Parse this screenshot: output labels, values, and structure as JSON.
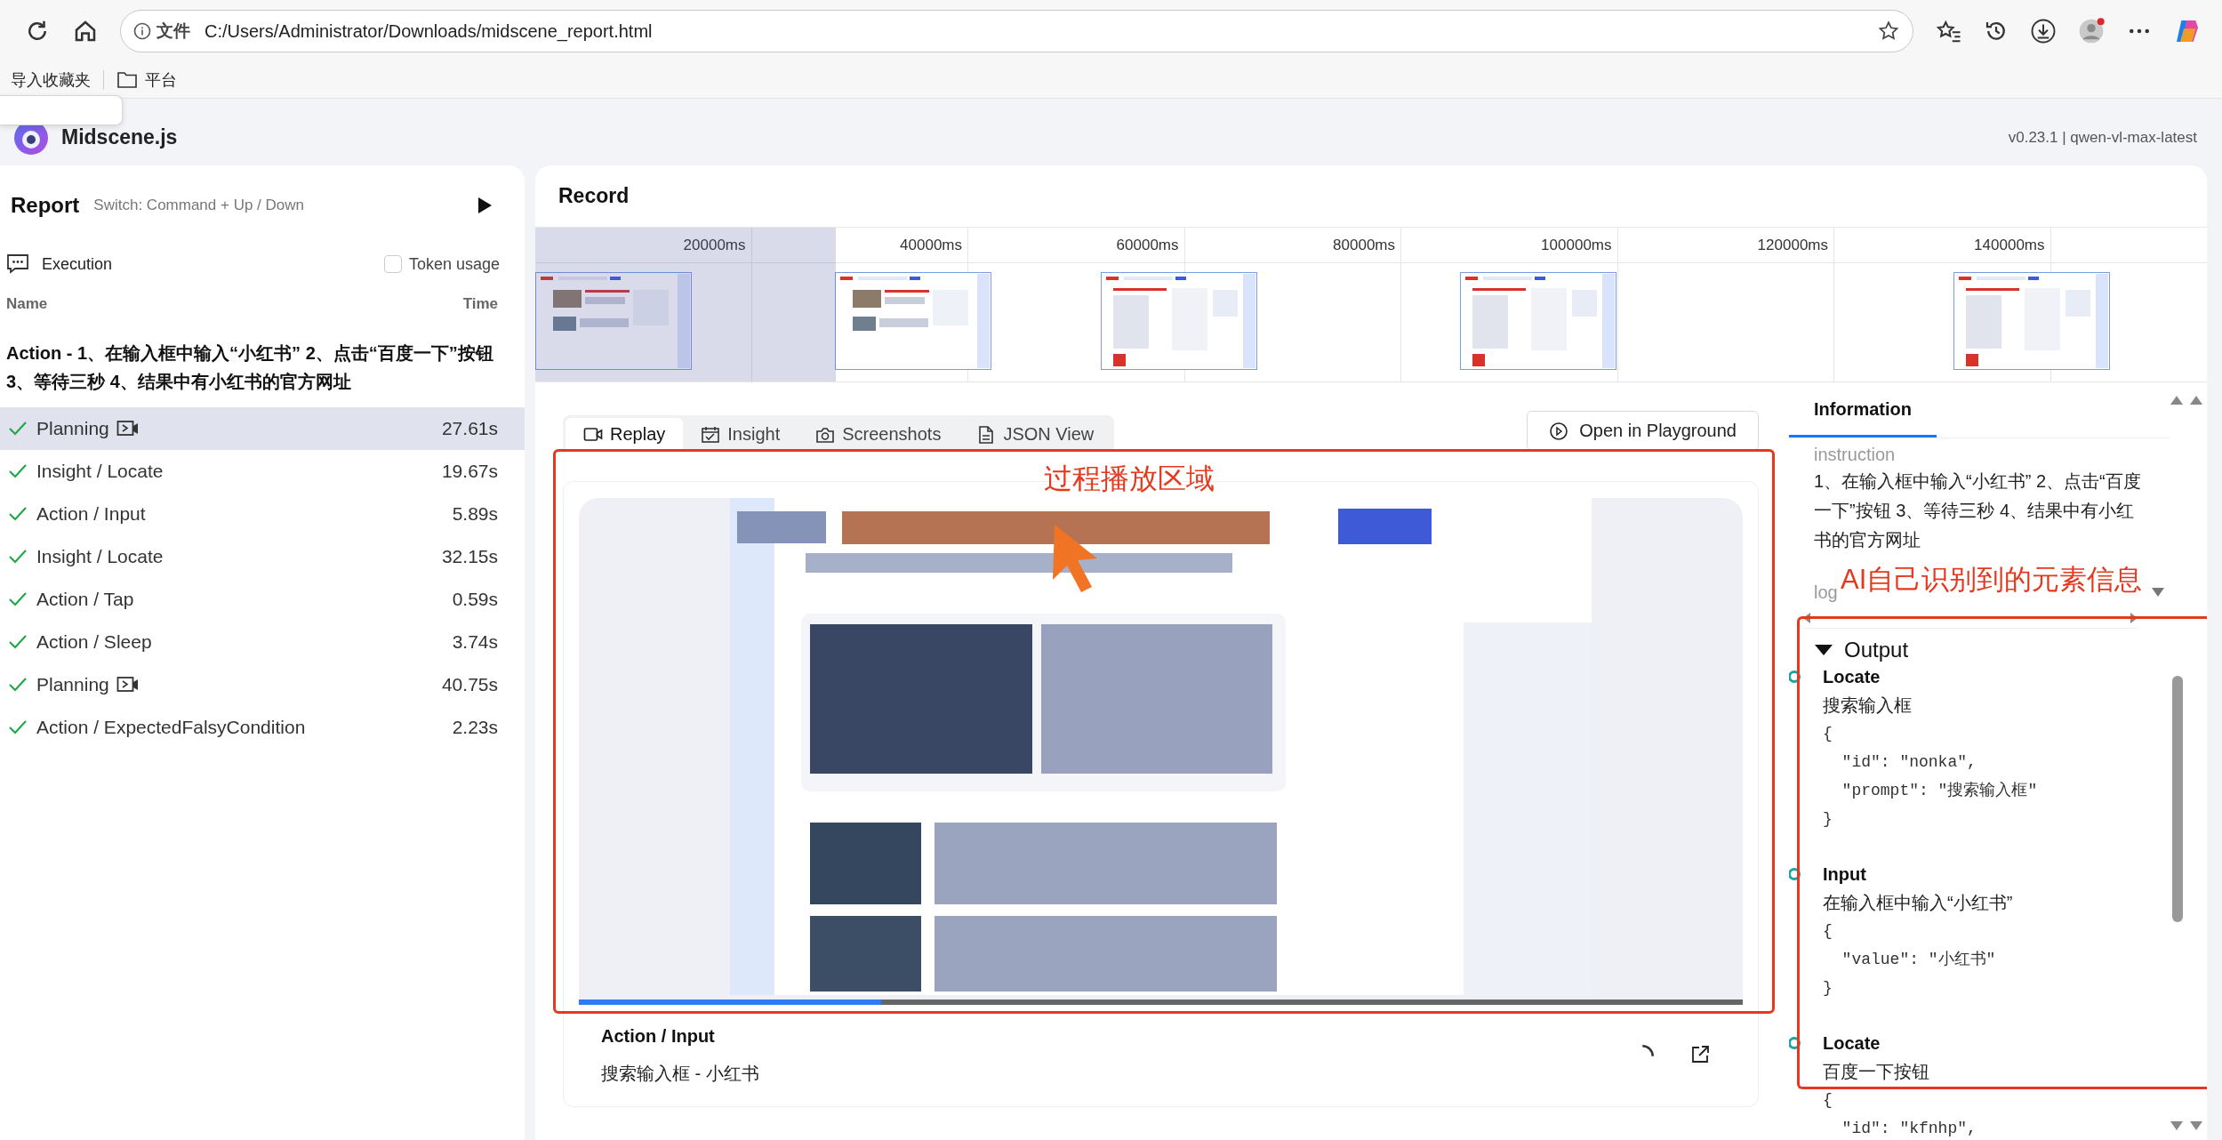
{
  "browser": {
    "address_prefix": "文件",
    "url": "C:/Users/Administrator/Downloads/midscene_report.html",
    "bookmarks": [
      {
        "kind": "link",
        "label": "导入收藏夹"
      },
      {
        "kind": "folder",
        "label": "平台"
      }
    ]
  },
  "app": {
    "name": "Midscene.js",
    "version": "v0.23.1 | qwen-vl-max-latest"
  },
  "sidebar": {
    "title": "Report",
    "hint": "Switch: Command + Up / Down",
    "section": "Execution",
    "token_usage": {
      "label": "Token usage",
      "checked": false
    },
    "columns": [
      "Name",
      "Time"
    ],
    "group_title": "Action - 1、在输入框中输入“小红书” 2、点击“百度一下”按钮 3、等待三秒 4、结果中有小红书的官方网址",
    "tasks": [
      {
        "name": "Planning",
        "time": "27.61s",
        "recorded": true,
        "selected": true
      },
      {
        "name": "Insight / Locate",
        "time": "19.67s",
        "recorded": false,
        "selected": false
      },
      {
        "name": "Action / Input",
        "time": "5.89s",
        "recorded": false,
        "selected": false
      },
      {
        "name": "Insight / Locate",
        "time": "32.15s",
        "recorded": false,
        "selected": false
      },
      {
        "name": "Action / Tap",
        "time": "0.59s",
        "recorded": false,
        "selected": false
      },
      {
        "name": "Action / Sleep",
        "time": "3.74s",
        "recorded": false,
        "selected": false
      },
      {
        "name": "Planning",
        "time": "40.75s",
        "recorded": true,
        "selected": false
      },
      {
        "name": "Action / ExpectedFalsyCondition",
        "time": "2.23s",
        "recorded": false,
        "selected": false
      }
    ]
  },
  "record": {
    "title": "Record",
    "ticks": [
      "20000ms",
      "40000ms",
      "60000ms",
      "80000ms",
      "100000ms",
      "120000ms",
      "140000ms"
    ]
  },
  "player": {
    "tabs": [
      {
        "kind": "video",
        "label": "Replay",
        "selected": true
      },
      {
        "kind": "calendar",
        "label": "Insight",
        "selected": false
      },
      {
        "kind": "camera",
        "label": "Screenshots",
        "selected": false
      },
      {
        "kind": "document",
        "label": "JSON View",
        "selected": false
      }
    ],
    "playground_button": "Open in Playground",
    "annotation": "过程播放区域",
    "progress": {
      "level": 0.26
    },
    "step": {
      "title": "Action / Input",
      "detail": "搜索输入框 - 小红书",
      "loading": true
    }
  },
  "information": {
    "tabs": [
      {
        "label": "Information",
        "selected": true
      }
    ],
    "instruction_label": "instruction",
    "instruction": "1、在输入框中输入“小红书” 2、点击“百度一下”按钮 3、等待三秒 4、结果中有小红书的官方网址",
    "log_label": "log",
    "annotation": "AI自己识别到的元素信息",
    "output": {
      "label": "Output",
      "expanded": true,
      "items": [
        {
          "name": "Locate",
          "prompt": "搜索输入框",
          "json": [
            "{",
            "  \"id\": \"nonka\",",
            "  \"prompt\": \"搜索输入框\"",
            "}"
          ]
        },
        {
          "name": "Input",
          "prompt": "在输入框中输入“小红书”",
          "json": [
            "{",
            "  \"value\": \"小红书\"",
            "}"
          ]
        },
        {
          "name": "Locate",
          "prompt": "百度一下按钮",
          "json": [
            "{",
            "  \"id\": \"kfnhp\","
          ]
        }
      ]
    }
  }
}
